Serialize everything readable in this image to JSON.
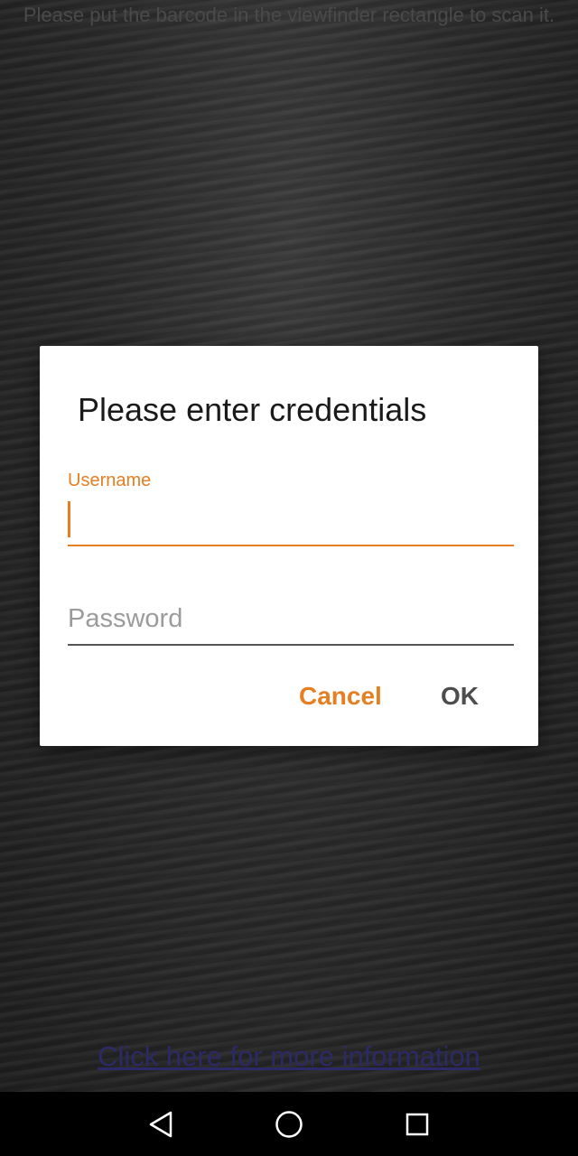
{
  "camera": {
    "hint_text": "Please put the barcode in the viewfinder rectangle to scan it."
  },
  "dialog": {
    "title": "Please enter credentials",
    "username": {
      "label": "Username",
      "value": ""
    },
    "password": {
      "placeholder": "Password",
      "value": ""
    },
    "buttons": {
      "cancel_label": "Cancel",
      "ok_label": "OK"
    }
  },
  "info_link": {
    "text": "Click here for more information"
  },
  "navbar": {
    "icons": [
      "back-icon",
      "home-icon",
      "recents-icon"
    ]
  },
  "colors": {
    "accent": "#e67e22",
    "link": "#2b2a66",
    "dialog_background": "#ffffff"
  }
}
